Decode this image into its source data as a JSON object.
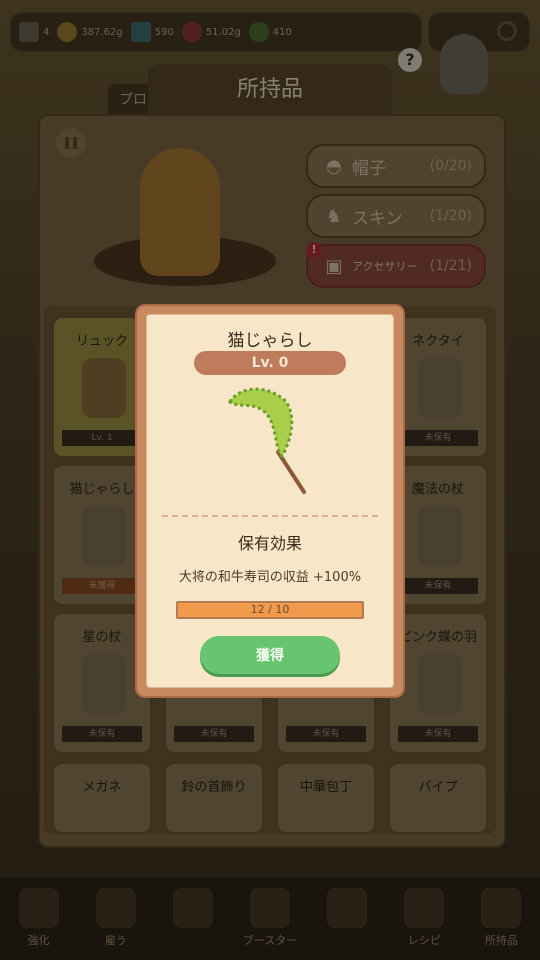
{
  "resources": [
    {
      "icon": "cat-head-icon",
      "value": "4"
    },
    {
      "icon": "coin-icon",
      "value": "387.62g"
    },
    {
      "icon": "gem-icon",
      "value": "590"
    },
    {
      "icon": "sushi-icon",
      "value": "51.02g"
    },
    {
      "icon": "leaf-icon",
      "value": "410"
    }
  ],
  "panel": {
    "title": "所持品",
    "back_tab": "プロ",
    "categories": [
      {
        "label": "帽子",
        "count": "(0/20)"
      },
      {
        "label": "スキン",
        "count": "(1/20)"
      },
      {
        "label": "アクセサリー",
        "count": "(1/21)"
      }
    ],
    "items": [
      {
        "name": "リュック",
        "status": "Lv. 1"
      },
      {
        "name": "猫じゃらし",
        "status": "未獲得"
      },
      {
        "name": "",
        "status": ""
      },
      {
        "name": "ネクタイ",
        "status": "未保有"
      },
      {
        "name": "",
        "status": ""
      },
      {
        "name": "魔法の杖",
        "status": "未保有"
      },
      {
        "name": "星の杖",
        "status": "未保有"
      },
      {
        "name": "",
        "status": "未保有"
      },
      {
        "name": "",
        "status": "未保有"
      },
      {
        "name": "ピンク蝶の羽",
        "status": "未保有"
      },
      {
        "name": "メガネ",
        "status": ""
      },
      {
        "name": "鈴の首飾り",
        "status": ""
      },
      {
        "name": "中華包丁",
        "status": ""
      },
      {
        "name": "パイプ",
        "status": ""
      }
    ]
  },
  "modal": {
    "title": "猫じゃらし",
    "level": "Lv. 0",
    "section_title": "保有効果",
    "effect": "大将の和牛寿司の収益 +100%",
    "progress_text": "12 / 10",
    "progress_fraction": 1.0,
    "button": "獲得"
  },
  "nav": [
    "強化",
    "雇う",
    "",
    "ブースター",
    "",
    "レシピ",
    "所持品"
  ],
  "colors": {
    "accent_green": "#68c56f",
    "progress_orange": "#f29a4c",
    "alert_red": "#b0303a"
  }
}
